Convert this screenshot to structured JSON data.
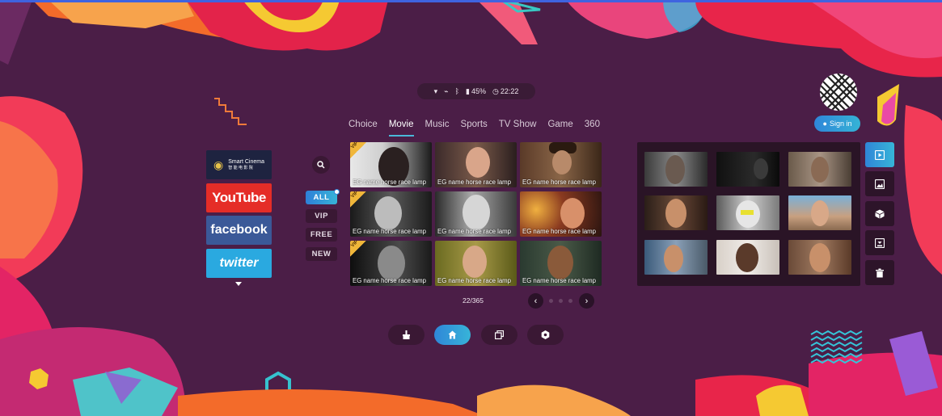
{
  "status_bar": {
    "battery": "45%",
    "time": "22:22"
  },
  "account": {
    "sign_in_label": "Sign in"
  },
  "tabs": [
    {
      "label": "Choice"
    },
    {
      "label": "Movie"
    },
    {
      "label": "Music"
    },
    {
      "label": "Sports"
    },
    {
      "label": "TV Show"
    },
    {
      "label": "Game"
    },
    {
      "label": "360"
    }
  ],
  "active_tab": "Movie",
  "social": [
    {
      "name": "smart-cinema",
      "label": "Smart Cinema",
      "sub": "智 能 电 影 院"
    },
    {
      "name": "youtube",
      "label": "YouTube"
    },
    {
      "name": "facebook",
      "label": "facebook"
    },
    {
      "name": "twitter",
      "label": "twitter"
    }
  ],
  "filters": [
    {
      "label": "ALL",
      "active": true
    },
    {
      "label": "VIP"
    },
    {
      "label": "FREE"
    },
    {
      "label": "NEW"
    }
  ],
  "movies": [
    {
      "caption": "EG name horse race lamp",
      "vip": true
    },
    {
      "caption": "EG name horse race lamp",
      "vip": false
    },
    {
      "caption": "EG name horse race lamp",
      "vip": false
    },
    {
      "caption": "EG name horse race lamp",
      "vip": true
    },
    {
      "caption": "EG name horse race lamp",
      "vip": false
    },
    {
      "caption": "EG name horse race lamp",
      "vip": false
    },
    {
      "caption": "EG name horse race lamp",
      "vip": true
    },
    {
      "caption": "EG name horse race lamp",
      "vip": false
    },
    {
      "caption": "EG name horse race lamp",
      "vip": false
    }
  ],
  "vip_badge": "VIP",
  "pager": {
    "text": "22/365"
  },
  "bottom_nav": [
    {
      "icon": "broom-icon"
    },
    {
      "icon": "home-icon",
      "active": true
    },
    {
      "icon": "gallery-icon"
    },
    {
      "icon": "settings-icon"
    }
  ],
  "side_tools": [
    {
      "icon": "video-icon",
      "active": true
    },
    {
      "icon": "image-icon"
    },
    {
      "icon": "cube-icon"
    },
    {
      "icon": "download-icon"
    },
    {
      "icon": "trash-icon"
    }
  ],
  "colors": {
    "background": "#4b1e47",
    "accent": "#37b4d8",
    "youtube": "#e52d27",
    "facebook": "#3b5998",
    "twitter": "#2aa9e0"
  }
}
